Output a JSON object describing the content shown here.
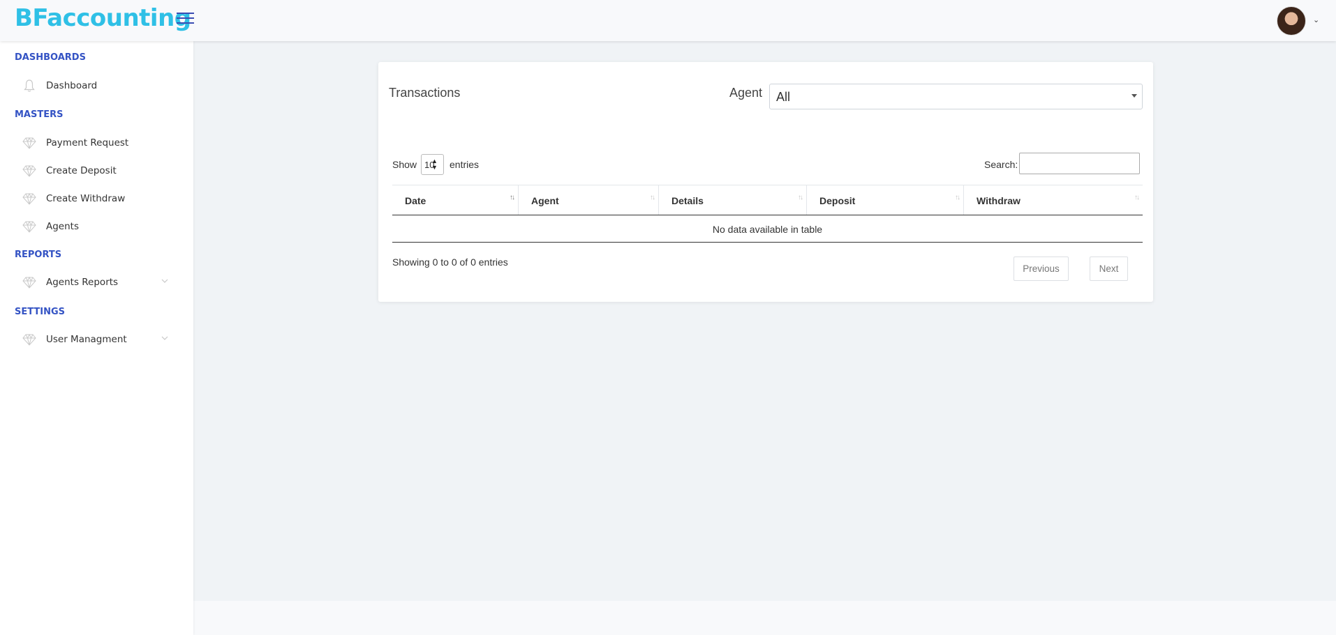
{
  "header": {
    "logo": "BFaccounting",
    "menu_icon": "hamburger-menu-icon",
    "avatar_icon": "user-avatar",
    "avatar_caret": "⌄"
  },
  "sidebar": {
    "sections": [
      {
        "title": "DASHBOARDS",
        "items": [
          {
            "label": "Dashboard",
            "icon": "bell-icon"
          }
        ]
      },
      {
        "title": "MASTERS",
        "items": [
          {
            "label": "Payment Request",
            "icon": "diamond-icon"
          },
          {
            "label": "Create Deposit",
            "icon": "diamond-icon"
          },
          {
            "label": "Create Withdraw",
            "icon": "diamond-icon"
          },
          {
            "label": "Agents",
            "icon": "diamond-icon"
          }
        ]
      },
      {
        "title": "REPORTS",
        "items": [
          {
            "label": "Agents Reports",
            "icon": "diamond-icon",
            "expandable": true
          }
        ]
      },
      {
        "title": "SETTINGS",
        "items": [
          {
            "label": "User Managment",
            "icon": "diamond-icon",
            "expandable": true
          }
        ]
      }
    ]
  },
  "card": {
    "title": "Transactions",
    "agent_label": "Agent",
    "agent_value": "All",
    "show_label": "Show",
    "page_length": "10",
    "entries_label": "entries",
    "search_label": "Search:",
    "search_value": "",
    "table": {
      "columns": [
        "Date",
        "Agent",
        "Details",
        "Deposit",
        "Withdraw"
      ],
      "empty_message": "No data available in table"
    },
    "info": "Showing 0 to 0 of 0 entries",
    "pagination": {
      "previous": "Previous",
      "next": "Next"
    }
  }
}
